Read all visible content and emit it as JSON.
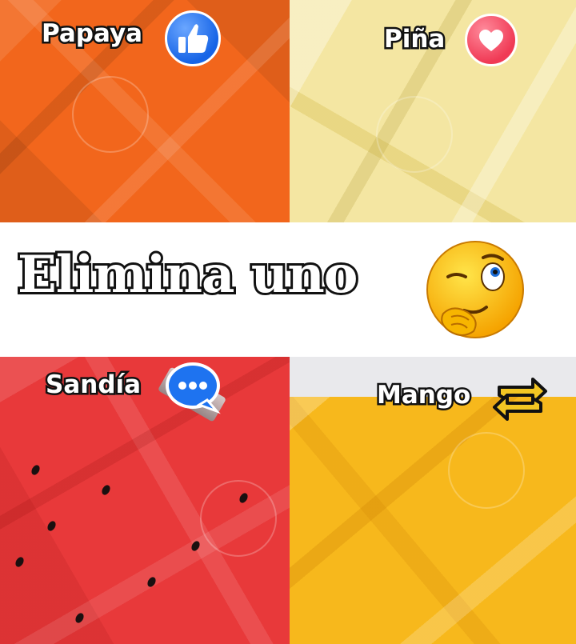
{
  "headline": "Elimina uno",
  "quadrants": {
    "top_left": {
      "label": "Papaya",
      "reaction": "like-icon"
    },
    "top_right": {
      "label": "Piña",
      "reaction": "love-icon"
    },
    "bottom_left": {
      "label": "Sandía",
      "reaction": "comment-icon"
    },
    "bottom_right": {
      "label": "Mango",
      "reaction": "share-icon"
    }
  },
  "emoji": "thinking-wink-emoji",
  "colors": {
    "papaya": "#f2661c",
    "pina": "#f4e6a2",
    "sandia": "#e8393a",
    "mango": "#f7b81c",
    "like_blue": "#1664e6",
    "love_red": "#f03a55",
    "comment_blue": "#1e73f0",
    "share_yellow": "#f3c623"
  }
}
